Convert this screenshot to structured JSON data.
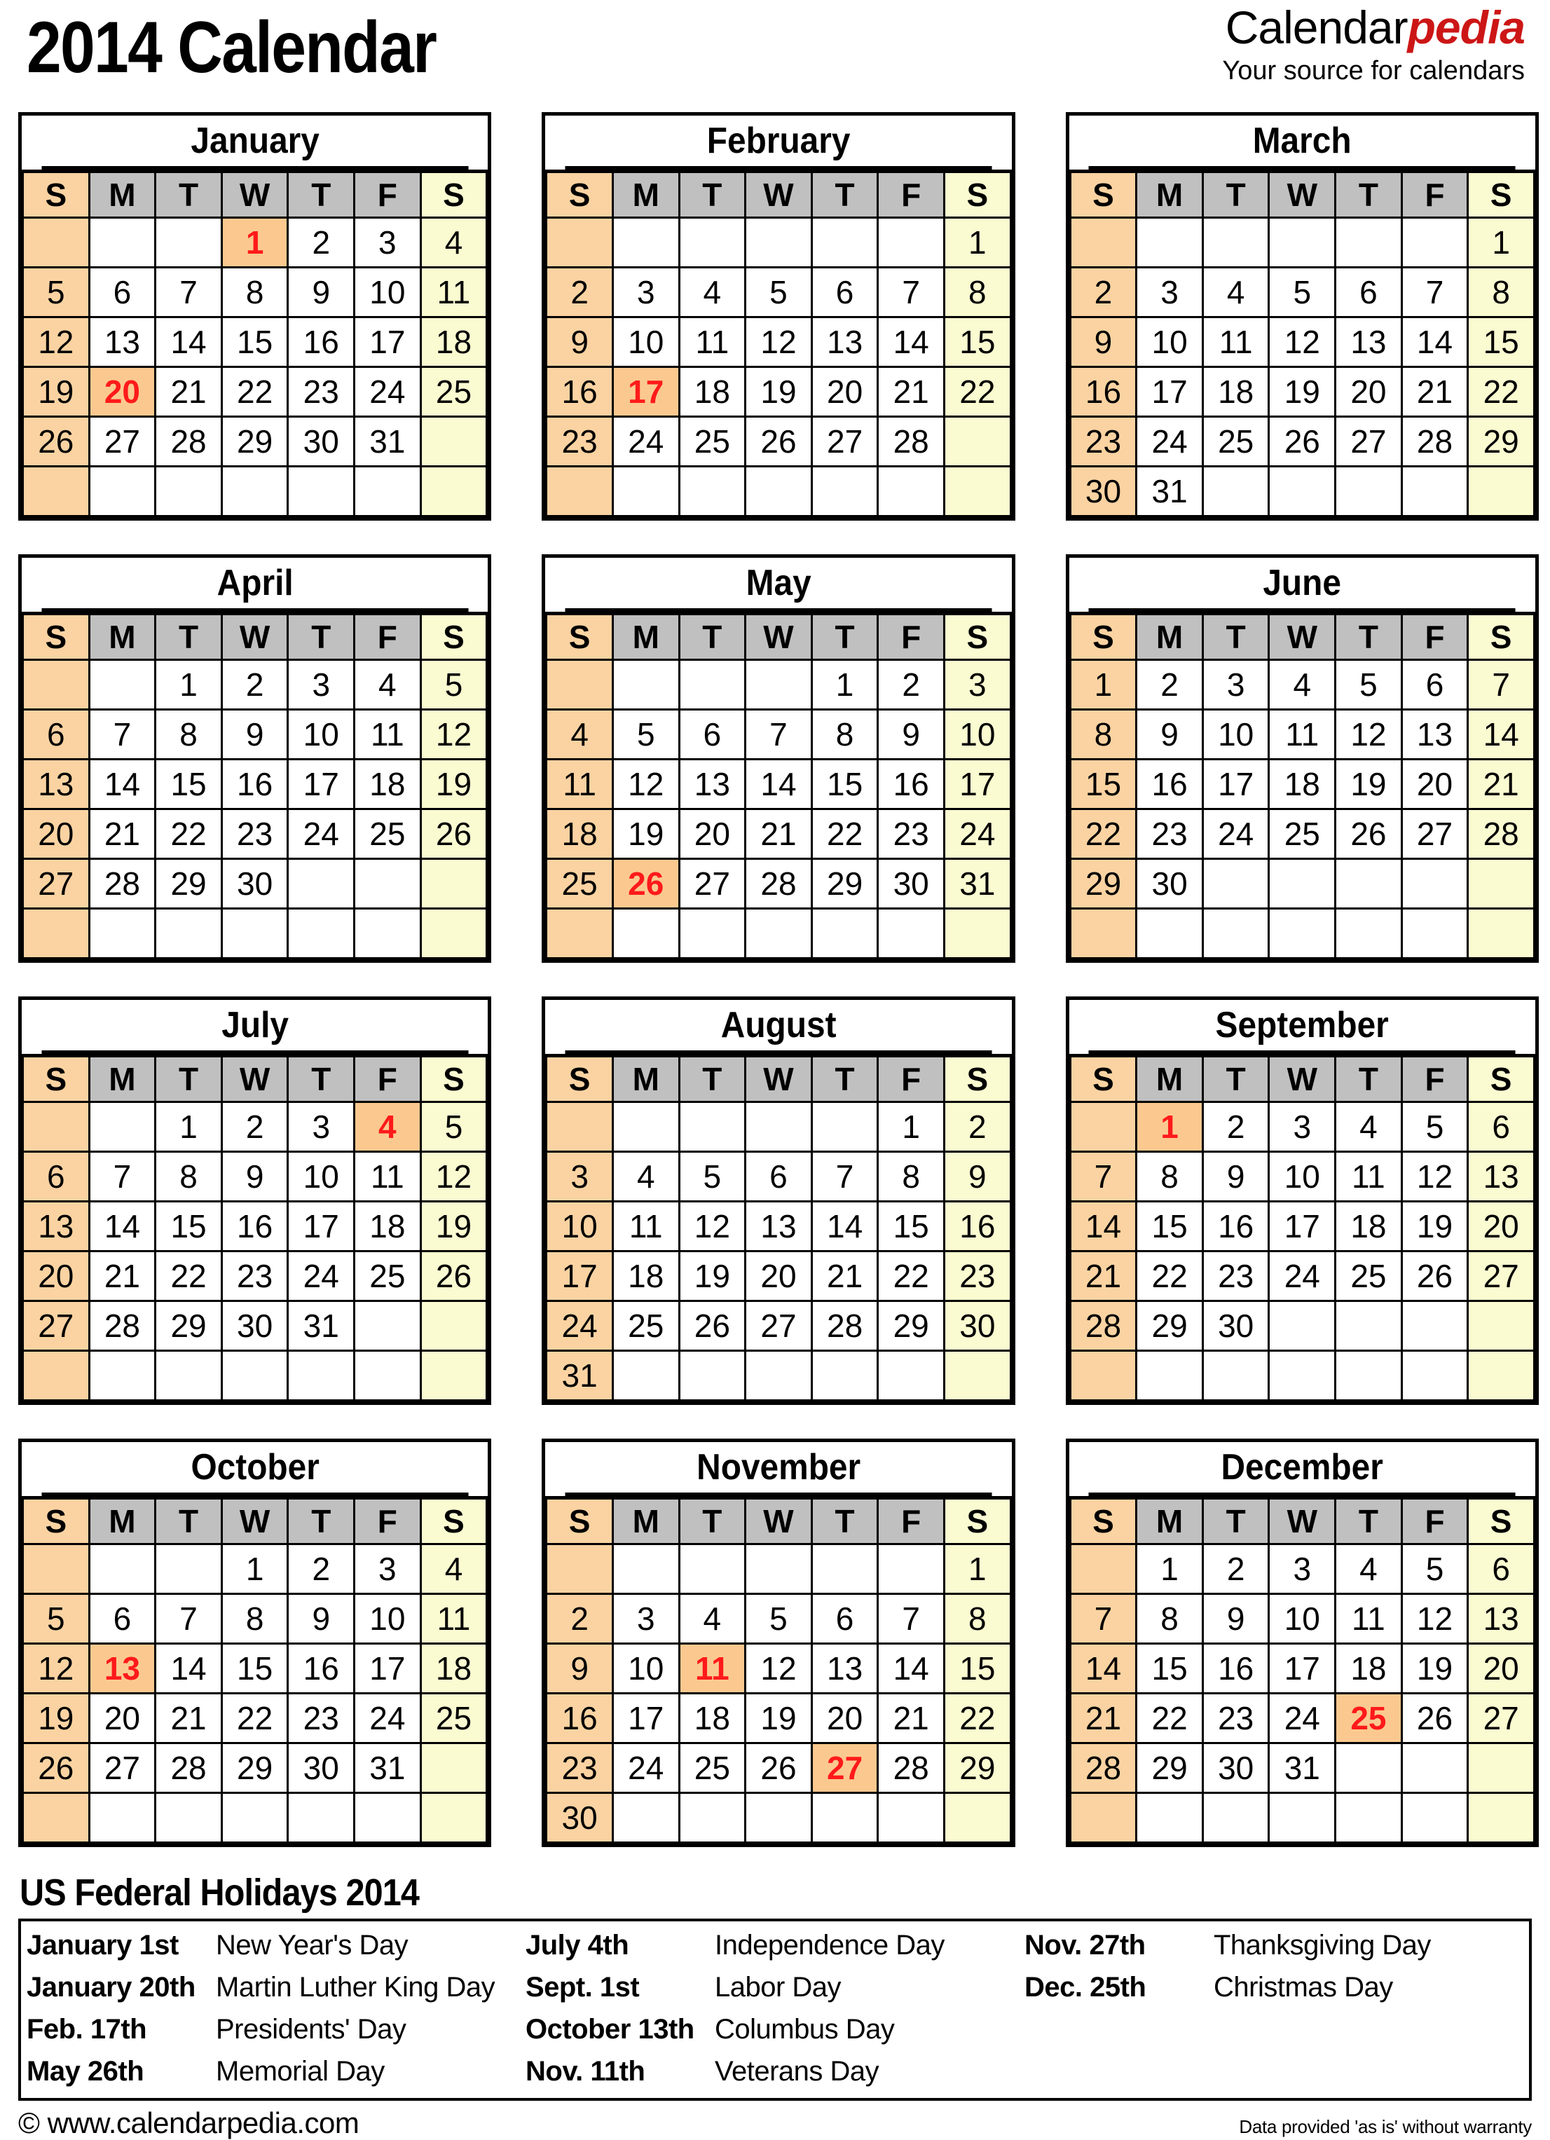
{
  "header": {
    "title": "2014 Calendar",
    "brand_first": "Calendar",
    "brand_second": "pedia",
    "brand_tagline": "Your source for calendars"
  },
  "colors": {
    "sunday_bg": "#fbd3a2",
    "saturday_bg": "#fbfbd1",
    "weekday_header_bg": "#c0c0c0",
    "holiday_bg": "#fbc98f",
    "holiday_text": "#ff1a1a",
    "brand_accent": "#cc1616",
    "border": "#000000"
  },
  "day_headers": [
    "S",
    "M",
    "T",
    "W",
    "T",
    "F",
    "S"
  ],
  "months": [
    {
      "name": "January",
      "weeks": [
        [
          "",
          "",
          "",
          "1",
          "2",
          "3",
          "4"
        ],
        [
          "5",
          "6",
          "7",
          "8",
          "9",
          "10",
          "11"
        ],
        [
          "12",
          "13",
          "14",
          "15",
          "16",
          "17",
          "18"
        ],
        [
          "19",
          "20",
          "21",
          "22",
          "23",
          "24",
          "25"
        ],
        [
          "26",
          "27",
          "28",
          "29",
          "30",
          "31",
          ""
        ],
        [
          "",
          "",
          "",
          "",
          "",
          "",
          ""
        ]
      ],
      "holidays": [
        "1",
        "20"
      ]
    },
    {
      "name": "February",
      "weeks": [
        [
          "",
          "",
          "",
          "",
          "",
          "",
          "1"
        ],
        [
          "2",
          "3",
          "4",
          "5",
          "6",
          "7",
          "8"
        ],
        [
          "9",
          "10",
          "11",
          "12",
          "13",
          "14",
          "15"
        ],
        [
          "16",
          "17",
          "18",
          "19",
          "20",
          "21",
          "22"
        ],
        [
          "23",
          "24",
          "25",
          "26",
          "27",
          "28",
          ""
        ],
        [
          "",
          "",
          "",
          "",
          "",
          "",
          ""
        ]
      ],
      "holidays": [
        "17"
      ]
    },
    {
      "name": "March",
      "weeks": [
        [
          "",
          "",
          "",
          "",
          "",
          "",
          "1"
        ],
        [
          "2",
          "3",
          "4",
          "5",
          "6",
          "7",
          "8"
        ],
        [
          "9",
          "10",
          "11",
          "12",
          "13",
          "14",
          "15"
        ],
        [
          "16",
          "17",
          "18",
          "19",
          "20",
          "21",
          "22"
        ],
        [
          "23",
          "24",
          "25",
          "26",
          "27",
          "28",
          "29"
        ],
        [
          "30",
          "31",
          "",
          "",
          "",
          "",
          ""
        ]
      ],
      "holidays": []
    },
    {
      "name": "April",
      "weeks": [
        [
          "",
          "",
          "1",
          "2",
          "3",
          "4",
          "5"
        ],
        [
          "6",
          "7",
          "8",
          "9",
          "10",
          "11",
          "12"
        ],
        [
          "13",
          "14",
          "15",
          "16",
          "17",
          "18",
          "19"
        ],
        [
          "20",
          "21",
          "22",
          "23",
          "24",
          "25",
          "26"
        ],
        [
          "27",
          "28",
          "29",
          "30",
          "",
          "",
          ""
        ],
        [
          "",
          "",
          "",
          "",
          "",
          "",
          ""
        ]
      ],
      "holidays": []
    },
    {
      "name": "May",
      "weeks": [
        [
          "",
          "",
          "",
          "",
          "1",
          "2",
          "3"
        ],
        [
          "4",
          "5",
          "6",
          "7",
          "8",
          "9",
          "10"
        ],
        [
          "11",
          "12",
          "13",
          "14",
          "15",
          "16",
          "17"
        ],
        [
          "18",
          "19",
          "20",
          "21",
          "22",
          "23",
          "24"
        ],
        [
          "25",
          "26",
          "27",
          "28",
          "29",
          "30",
          "31"
        ],
        [
          "",
          "",
          "",
          "",
          "",
          "",
          ""
        ]
      ],
      "holidays": [
        "26"
      ]
    },
    {
      "name": "June",
      "weeks": [
        [
          "1",
          "2",
          "3",
          "4",
          "5",
          "6",
          "7"
        ],
        [
          "8",
          "9",
          "10",
          "11",
          "12",
          "13",
          "14"
        ],
        [
          "15",
          "16",
          "17",
          "18",
          "19",
          "20",
          "21"
        ],
        [
          "22",
          "23",
          "24",
          "25",
          "26",
          "27",
          "28"
        ],
        [
          "29",
          "30",
          "",
          "",
          "",
          "",
          ""
        ],
        [
          "",
          "",
          "",
          "",
          "",
          "",
          ""
        ]
      ],
      "holidays": []
    },
    {
      "name": "July",
      "weeks": [
        [
          "",
          "",
          "1",
          "2",
          "3",
          "4",
          "5"
        ],
        [
          "6",
          "7",
          "8",
          "9",
          "10",
          "11",
          "12"
        ],
        [
          "13",
          "14",
          "15",
          "16",
          "17",
          "18",
          "19"
        ],
        [
          "20",
          "21",
          "22",
          "23",
          "24",
          "25",
          "26"
        ],
        [
          "27",
          "28",
          "29",
          "30",
          "31",
          "",
          ""
        ],
        [
          "",
          "",
          "",
          "",
          "",
          "",
          ""
        ]
      ],
      "holidays": [
        "4"
      ]
    },
    {
      "name": "August",
      "weeks": [
        [
          "",
          "",
          "",
          "",
          "",
          "1",
          "2"
        ],
        [
          "3",
          "4",
          "5",
          "6",
          "7",
          "8",
          "9"
        ],
        [
          "10",
          "11",
          "12",
          "13",
          "14",
          "15",
          "16"
        ],
        [
          "17",
          "18",
          "19",
          "20",
          "21",
          "22",
          "23"
        ],
        [
          "24",
          "25",
          "26",
          "27",
          "28",
          "29",
          "30"
        ],
        [
          "31",
          "",
          "",
          "",
          "",
          "",
          ""
        ]
      ],
      "holidays": []
    },
    {
      "name": "September",
      "weeks": [
        [
          "",
          "1",
          "2",
          "3",
          "4",
          "5",
          "6"
        ],
        [
          "7",
          "8",
          "9",
          "10",
          "11",
          "12",
          "13"
        ],
        [
          "14",
          "15",
          "16",
          "17",
          "18",
          "19",
          "20"
        ],
        [
          "21",
          "22",
          "23",
          "24",
          "25",
          "26",
          "27"
        ],
        [
          "28",
          "29",
          "30",
          "",
          "",
          "",
          ""
        ],
        [
          "",
          "",
          "",
          "",
          "",
          "",
          ""
        ]
      ],
      "holidays": [
        "1"
      ]
    },
    {
      "name": "October",
      "weeks": [
        [
          "",
          "",
          "",
          "1",
          "2",
          "3",
          "4"
        ],
        [
          "5",
          "6",
          "7",
          "8",
          "9",
          "10",
          "11"
        ],
        [
          "12",
          "13",
          "14",
          "15",
          "16",
          "17",
          "18"
        ],
        [
          "19",
          "20",
          "21",
          "22",
          "23",
          "24",
          "25"
        ],
        [
          "26",
          "27",
          "28",
          "29",
          "30",
          "31",
          ""
        ],
        [
          "",
          "",
          "",
          "",
          "",
          "",
          ""
        ]
      ],
      "holidays": [
        "13"
      ]
    },
    {
      "name": "November",
      "weeks": [
        [
          "",
          "",
          "",
          "",
          "",
          "",
          "1"
        ],
        [
          "2",
          "3",
          "4",
          "5",
          "6",
          "7",
          "8"
        ],
        [
          "9",
          "10",
          "11",
          "12",
          "13",
          "14",
          "15"
        ],
        [
          "16",
          "17",
          "18",
          "19",
          "20",
          "21",
          "22"
        ],
        [
          "23",
          "24",
          "25",
          "26",
          "27",
          "28",
          "29"
        ],
        [
          "30",
          "",
          "",
          "",
          "",
          "",
          ""
        ]
      ],
      "holidays": [
        "11",
        "27"
      ]
    },
    {
      "name": "December",
      "weeks": [
        [
          "",
          "1",
          "2",
          "3",
          "4",
          "5",
          "6"
        ],
        [
          "7",
          "8",
          "9",
          "10",
          "11",
          "12",
          "13"
        ],
        [
          "14",
          "15",
          "16",
          "17",
          "18",
          "19",
          "20"
        ],
        [
          "21",
          "22",
          "23",
          "24",
          "25",
          "26",
          "27"
        ],
        [
          "28",
          "29",
          "30",
          "31",
          "",
          "",
          ""
        ],
        [
          "",
          "",
          "",
          "",
          "",
          "",
          ""
        ]
      ],
      "holidays": [
        "25"
      ]
    }
  ],
  "footer": {
    "title": "US Federal Holidays 2014",
    "columns": [
      [
        {
          "date": "January 1st",
          "name": "New Year's Day"
        },
        {
          "date": "January 20th",
          "name": "Martin Luther King Day"
        },
        {
          "date": "Feb. 17th",
          "name": "Presidents' Day"
        },
        {
          "date": "May 26th",
          "name": "Memorial Day"
        }
      ],
      [
        {
          "date": "July 4th",
          "name": "Independence Day"
        },
        {
          "date": "Sept. 1st",
          "name": "Labor Day"
        },
        {
          "date": "October 13th",
          "name": "Columbus Day"
        },
        {
          "date": "Nov. 11th",
          "name": "Veterans Day"
        }
      ],
      [
        {
          "date": "Nov. 27th",
          "name": "Thanksgiving Day"
        },
        {
          "date": "Dec. 25th",
          "name": "Christmas Day"
        },
        {
          "date": "",
          "name": ""
        },
        {
          "date": "",
          "name": ""
        }
      ]
    ],
    "copyright": "© www.calendarpedia.com",
    "disclaimer": "Data provided 'as is' without warranty"
  }
}
